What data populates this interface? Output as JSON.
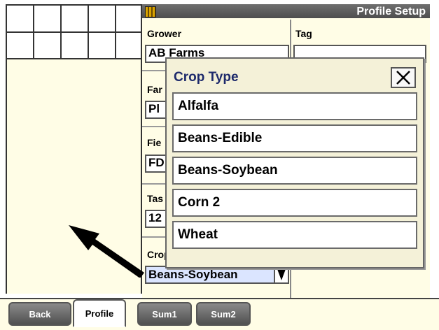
{
  "header": {
    "title": "Profile Setup",
    "flag_icon": "grid-flag-icon"
  },
  "fields": {
    "grower": {
      "label": "Grower",
      "value": "AB Farms"
    },
    "tag": {
      "label": "Tag",
      "value": ""
    },
    "farm": {
      "label": "Far",
      "value": "Pl"
    },
    "field": {
      "label": "Fie",
      "value": "FD"
    },
    "task": {
      "label": "Tas",
      "value": "12"
    },
    "crop_type": {
      "label": "Crop Type",
      "value": "Beans-Soybean"
    }
  },
  "popup": {
    "title": "Crop Type",
    "close_icon": "close-icon",
    "options": [
      "Alfalfa",
      "Beans-Edible",
      "Beans-Soybean",
      "Corn 2",
      "Wheat"
    ]
  },
  "tabs": [
    "Back",
    "Profile",
    "Sum1",
    "Sum2"
  ],
  "annotation": {
    "arrow": "pointer-arrow",
    "color": "#000000"
  },
  "colors": {
    "panel": "#fffde6",
    "popup_title": "#1d2a6b",
    "dropdown": "#dbe5ff"
  }
}
